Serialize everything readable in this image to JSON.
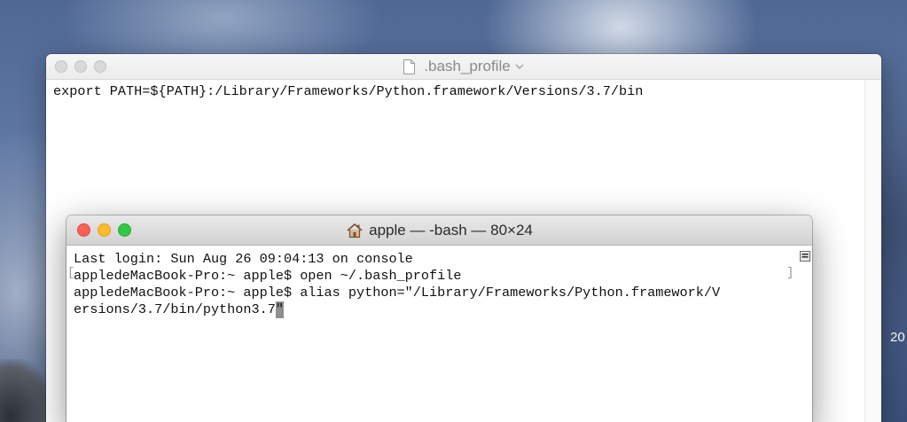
{
  "desktop": {
    "clock_fragment": "20"
  },
  "editor": {
    "title": ".bash_profile",
    "content": "export PATH=${PATH}:/Library/Frameworks/Python.framework/Versions/3.7/bin"
  },
  "terminal": {
    "title": "apple — -bash — 80×24",
    "lines": [
      "Last login: Sun Aug 26 09:04:13 on console",
      "appledeMacBook-Pro:~ apple$ open ~/.bash_profile",
      "appledeMacBook-Pro:~ apple$ alias python=\"/Library/Frameworks/Python.framework/V",
      "ersions/3.7/bin/python3.7"
    ],
    "cursor_char": "\""
  },
  "icons": {
    "editor_doc": "document-icon",
    "title_dropdown": "chevron-down-icon",
    "terminal_home": "home-icon",
    "scroll_menu": "list-menu-icon"
  },
  "colors": {
    "close": "#fc5f57",
    "minimize": "#fdbc2e",
    "zoom": "#33c748"
  }
}
